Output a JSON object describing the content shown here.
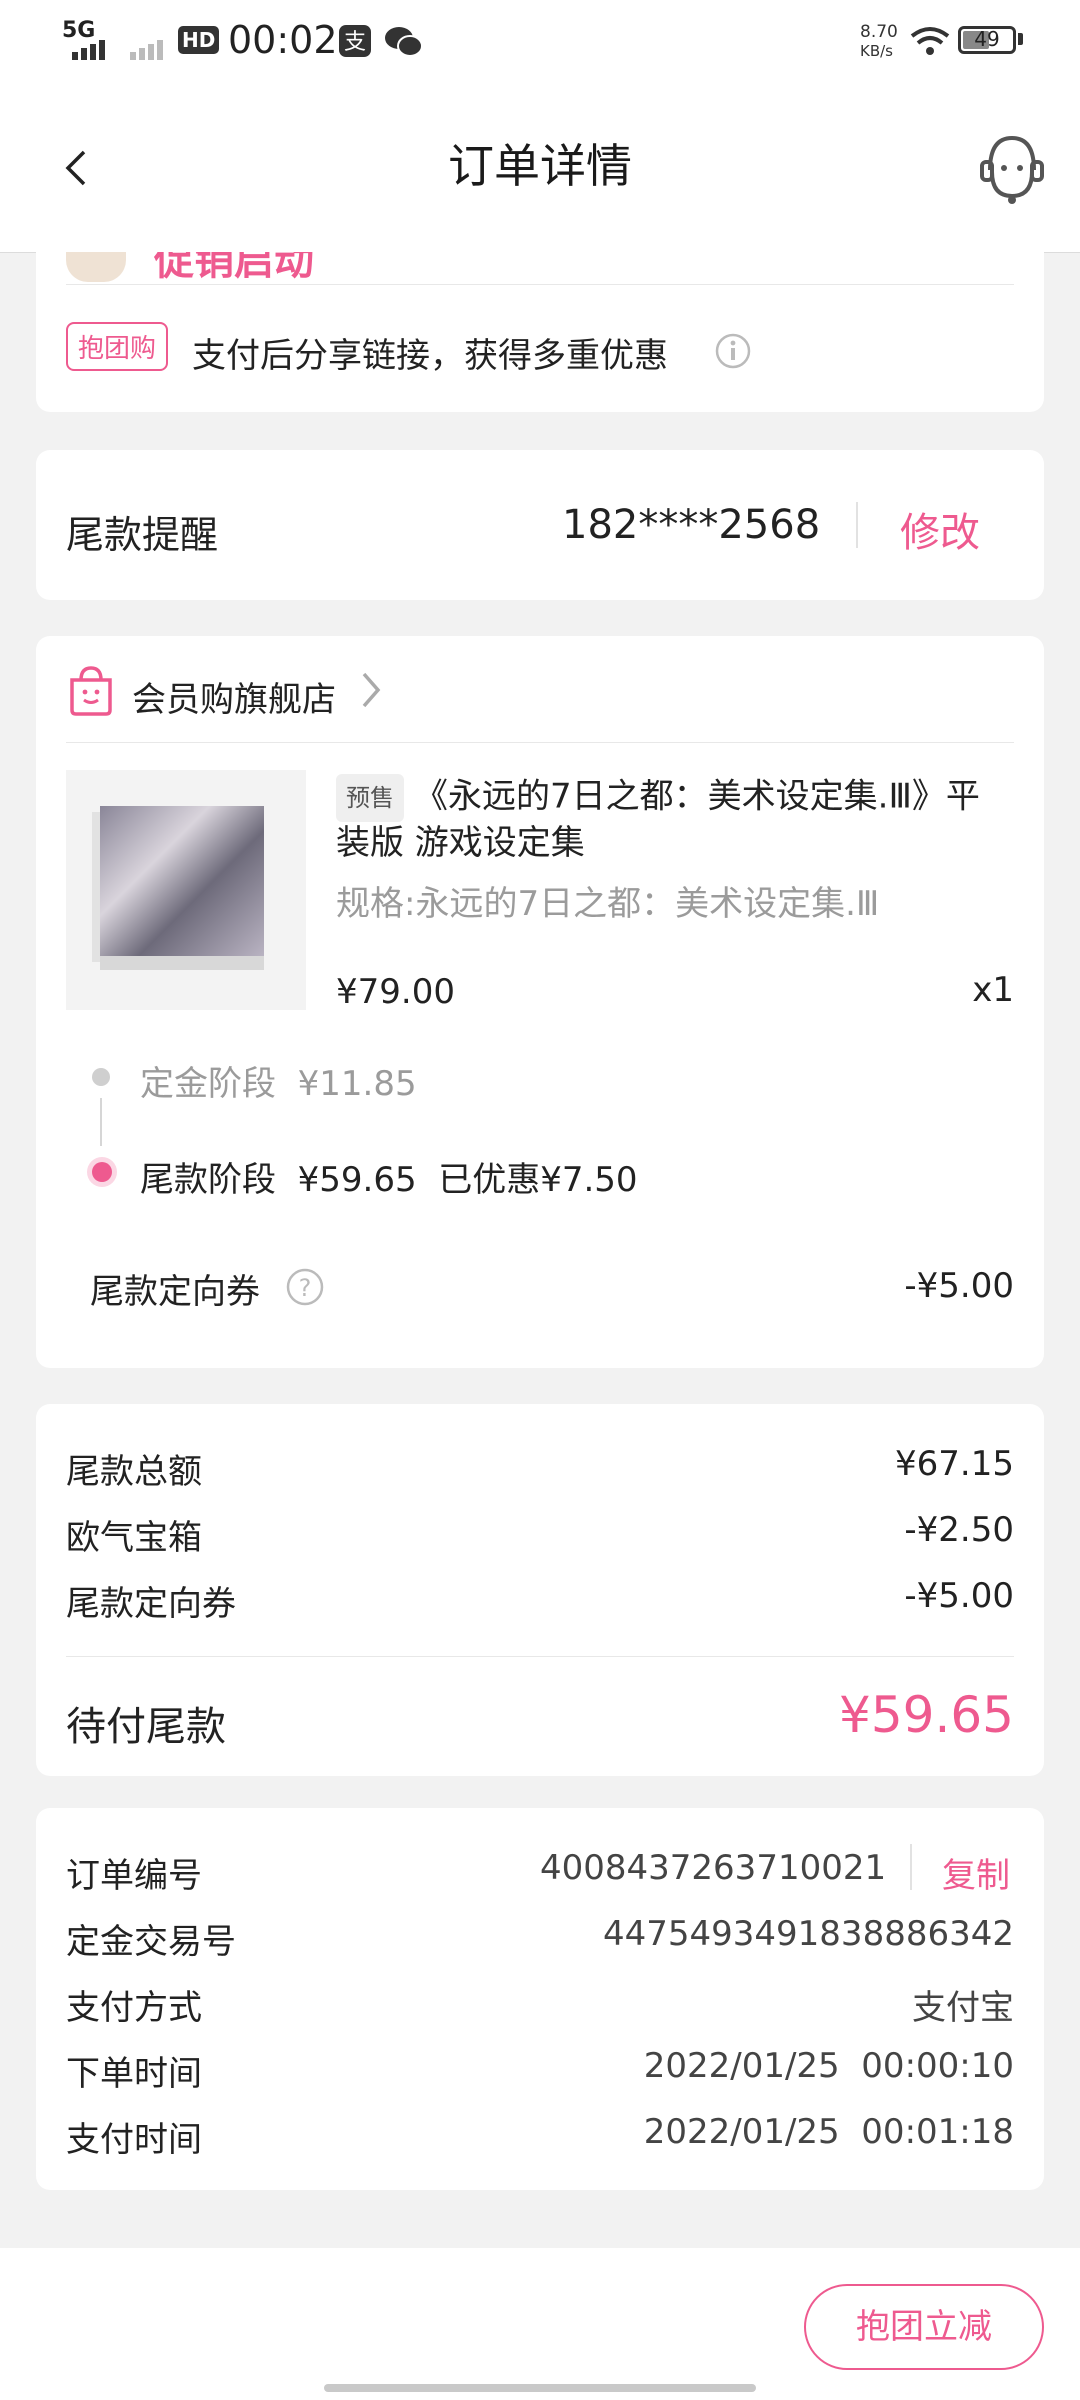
{
  "status_bar": {
    "network": "5G",
    "hd": "HD",
    "time": "00:02",
    "speed": "8.70",
    "speed_unit": "KB/s",
    "battery": "49"
  },
  "header": {
    "title": "订单详情"
  },
  "promo": {
    "banner_text": "促销启动",
    "tag": "抱团购",
    "text": "支付后分享链接，获得多重优惠"
  },
  "reminder": {
    "label": "尾款提醒",
    "phone": "182****2568",
    "edit": "修改"
  },
  "store": {
    "name": "会员购旗舰店",
    "product": {
      "presale_tag": "预售",
      "title": "《永远的7日之都：美术设定集.Ⅲ》平装版 游戏设定集",
      "spec": "规格:永远的7日之都：美术设定集.Ⅲ",
      "price": "¥79.00",
      "qty": "x1"
    },
    "stages": [
      {
        "label": "定金阶段",
        "amount": "¥11.85",
        "extra": ""
      },
      {
        "label": "尾款阶段",
        "amount": "¥59.65",
        "extra": "已优惠¥7.50"
      }
    ],
    "coupon_label": "尾款定向券",
    "coupon_value": "-¥5.00"
  },
  "summary": {
    "items": [
      {
        "label": "尾款总额",
        "value": "¥67.15"
      },
      {
        "label": "欧气宝箱",
        "value": "-¥2.50"
      },
      {
        "label": "尾款定向券",
        "value": "-¥5.00"
      }
    ],
    "due_label": "待付尾款",
    "due_value": "¥59.65"
  },
  "order_info": {
    "order_no_label": "订单编号",
    "order_no": "4008437263710021",
    "copy": "复制",
    "rows": [
      {
        "label": "定金交易号",
        "value": "4475493491838886342"
      },
      {
        "label": "支付方式",
        "value": "支付宝"
      },
      {
        "label": "下单时间",
        "value": "2022/01/25  00:00:10"
      },
      {
        "label": "支付时间",
        "value": "2022/01/25  00:01:18"
      }
    ]
  },
  "bottom": {
    "action": "抱团立减"
  },
  "colors": {
    "accent": "#ee5a8f",
    "background": "#f2f2f2",
    "card": "#ffffff"
  }
}
